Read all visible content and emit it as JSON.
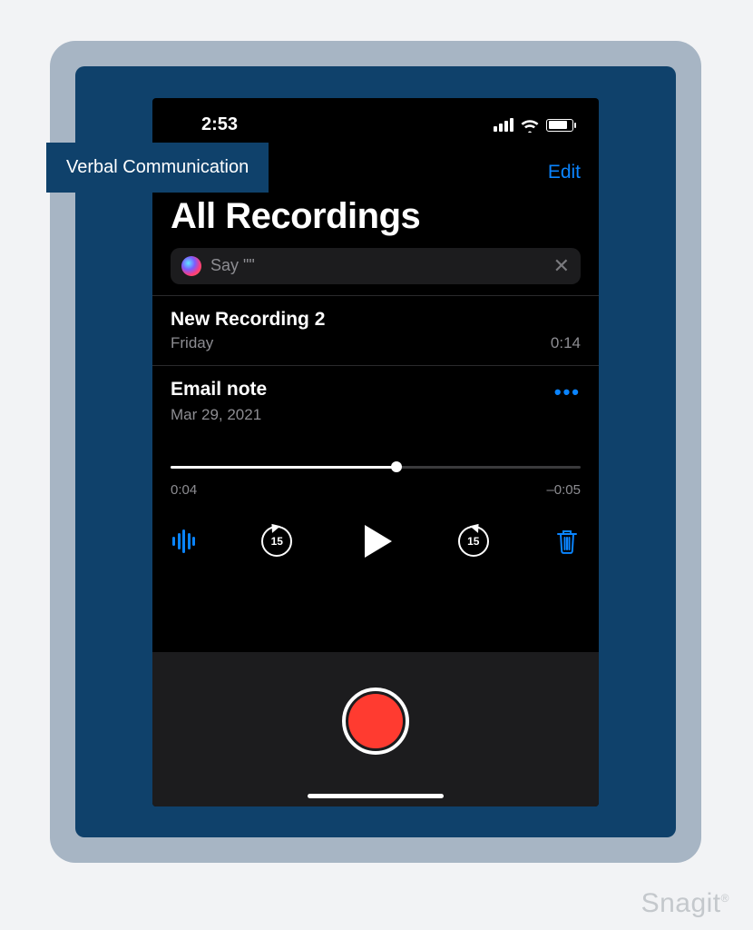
{
  "callout": {
    "label": "Verbal Communication"
  },
  "statusbar": {
    "time": "2:53"
  },
  "header": {
    "edit_label": "Edit",
    "title": "All Recordings"
  },
  "siri": {
    "prompt": "Say \"\""
  },
  "recordings": [
    {
      "title": "New Recording 2",
      "date": "Friday",
      "duration": "0:14"
    },
    {
      "title": "Email note",
      "date": "Mar 29, 2021"
    }
  ],
  "player": {
    "elapsed": "0:04",
    "remaining": "–0:05",
    "progress_percent": 55,
    "skip_seconds": "15"
  },
  "watermark": {
    "text": "Snagit"
  }
}
